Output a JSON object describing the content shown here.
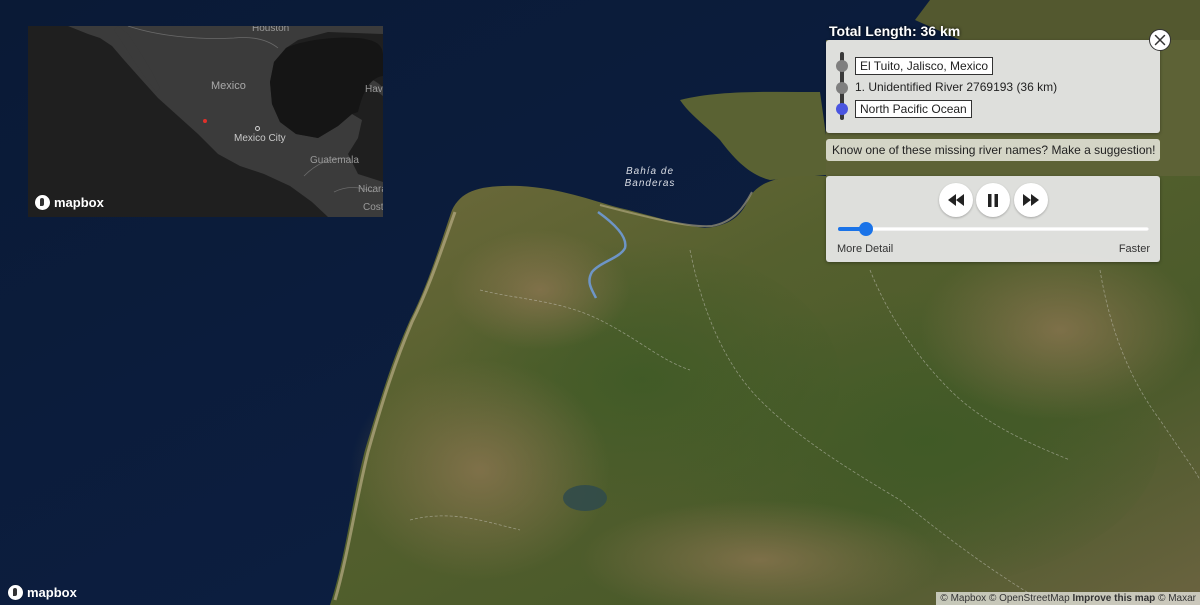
{
  "main_map": {
    "bay_label": "Bahía de\nBanderas",
    "logo_text": "mapbox",
    "attribution": {
      "mapbox": "© Mapbox",
      "osm": "© OpenStreetMap",
      "improve": "Improve this map",
      "maxar": "© Maxar"
    }
  },
  "inset_map": {
    "labels": {
      "houston": "Houston",
      "mexico": "Mexico",
      "havana": "Hava",
      "mexico_city": "Mexico City",
      "guatemala": "Guatemala",
      "nicaragua": "Nicara",
      "costa_rica": "Costa"
    },
    "logo_text": "mapbox",
    "marker_color": "#e0302a"
  },
  "panel": {
    "total_length": "Total Length: 36 km",
    "route": [
      {
        "label": "El Tuito, Jalisco, Mexico",
        "dot_color": "#7f7f7f"
      },
      {
        "label": "1. Unidentified River 2769193 (36 km)",
        "dot_color": "#7f7f7f"
      },
      {
        "label": "North Pacific Ocean",
        "dot_color": "#4a55e0"
      }
    ],
    "suggestion": "Know one of these missing river names? Make a suggestion!",
    "controls": {
      "rewind_icon": "rewind-icon",
      "pause_icon": "pause-icon",
      "forward_icon": "fast-forward-icon"
    },
    "speed_slider": {
      "value": 0.09,
      "min_label": "More Detail",
      "max_label": "Faster",
      "color": "#1a73e8"
    }
  }
}
